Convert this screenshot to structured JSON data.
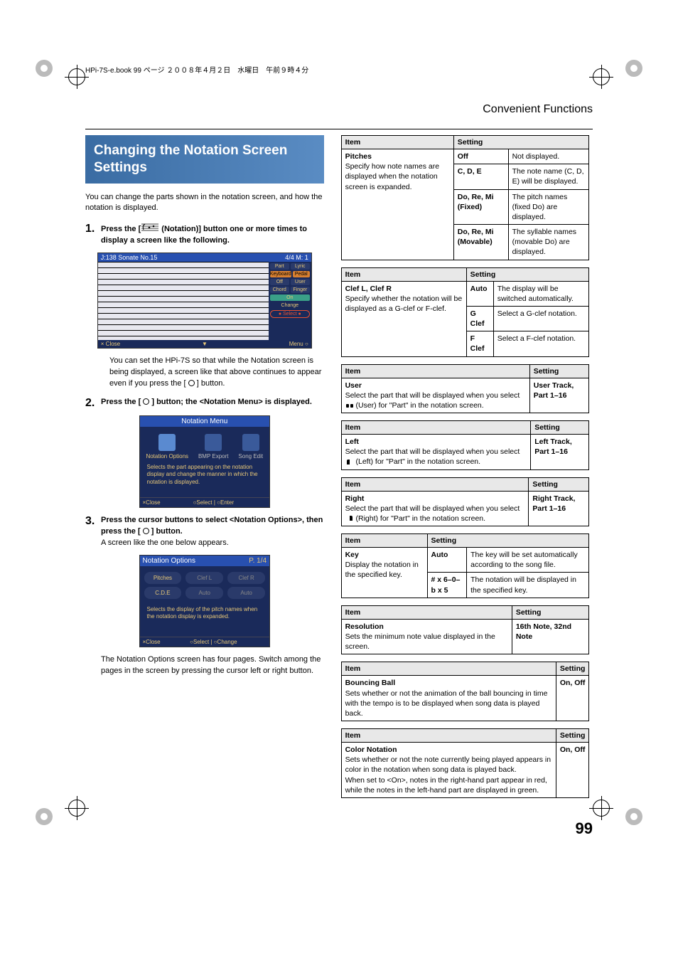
{
  "header_book": "HPi-7S-e.book  99 ページ  ２００８年４月２日　水曜日　午前９時４分",
  "breadcrumb": "Convenient Functions",
  "blue_title": "Changing the Notation Screen Settings",
  "intro": "You can change the parts shown in the notation screen, and how the notation is displayed.",
  "step1_pre": "Press the [",
  "step1_post": " (Notation)] button one or more times to display a screen like the following.",
  "shot1": {
    "title": "J:138 Sonate No.15",
    "meter": "4/4  M:  1",
    "side": {
      "part_l": "Part",
      "lyric": "Lyric",
      "kbd": "Keyboard",
      "pedal": "Pedal",
      "off": "Off",
      "user": "User",
      "chord": "Chord",
      "finger": "Finger",
      "on": "On",
      "change": "Change",
      "select": "Select"
    },
    "foot_l": "× Close",
    "foot_r": "Menu ○"
  },
  "step1_note": "You can set the HPi-7S so that while the Notation screen is being displayed, a screen like that above continues to appear even if you press the [     ] button.",
  "step2": "Press the [      ] button; the <Notation Menu> is displayed.",
  "shot2": {
    "title": "Notation Menu",
    "opt1": "Notation Options",
    "opt2": "BMP Export",
    "opt3": "Song Edit",
    "desc": "Selects the part appearing on the notation display and change the manner in which the notation is displayed.",
    "foot_l": "×Close",
    "foot_c": "○Select",
    "foot_r": "○Enter"
  },
  "step3_a": "Press the cursor buttons to select <Notation Options>, then press the [     ] button.",
  "step3_b": "A screen like the one below appears.",
  "shot3": {
    "title": "Notation Options",
    "pg": "P. 1/4",
    "p1": "Pitches",
    "p2": "Clef L",
    "p3": "Clef R",
    "v1": "C.D.E",
    "v2": "Auto",
    "v3": "Auto",
    "desc": "Selects the display of the pitch names when the notation display is expanded.",
    "foot_l": "×Close",
    "foot_c": "○Select",
    "foot_r": "○Change"
  },
  "step3_foot": "The Notation Options screen has four pages. Switch among the pages in the screen by pressing the cursor left or right button.",
  "th_item": "Item",
  "th_setting": "Setting",
  "t1": {
    "item": "Pitches",
    "desc": "Specify how note names are displayed when the notation screen is expanded.",
    "rows": [
      {
        "s": "Off",
        "d": "Not displayed."
      },
      {
        "s": "C, D, E",
        "d": "The note name (C, D, E) will be displayed."
      },
      {
        "s": "Do, Re, Mi (Fixed)",
        "d": "The pitch names (fixed Do) are displayed."
      },
      {
        "s": "Do, Re, Mi (Movable)",
        "d": "The syllable names (movable Do) are displayed."
      }
    ]
  },
  "t2": {
    "item": "Clef L, Clef R",
    "desc": "Specify whether the notation will be displayed as a G-clef or F-clef.",
    "rows": [
      {
        "s": "Auto",
        "d": "The display will be switched automatically."
      },
      {
        "s": "G Clef",
        "d": "Select a G-clef notation."
      },
      {
        "s": "F Clef",
        "d": "Select a F-clef notation."
      }
    ]
  },
  "t3": {
    "item": "User",
    "desc1": "Select the part that will be displayed when you select ",
    "desc2": " (User) for \"Part\" in the notation screen.",
    "setting": "User Track, Part 1–16"
  },
  "t4": {
    "item": "Left",
    "desc1": "Select the part that will be displayed when you select ",
    "desc2": " (Left) for \"Part\" in the notation screen.",
    "setting": "Left Track, Part 1–16"
  },
  "t5": {
    "item": "Right",
    "desc1": "Select the part that will be displayed when you select ",
    "desc2": " (Right) for \"Part\" in the notation screen.",
    "setting": "Right Track, Part 1–16"
  },
  "t6": {
    "item": "Key",
    "desc": "Display the notation in the specified key.",
    "rows": [
      {
        "s": "Auto",
        "d": "The key will be set automatically according to the song file."
      },
      {
        "s": "# x 6–0– b x 5",
        "d": "The notation will be displayed in the specified key."
      }
    ]
  },
  "t7": {
    "item": "Resolution",
    "desc": "Sets the minimum note value displayed in the screen.",
    "setting": "16th Note, 32nd Note"
  },
  "t8": {
    "item": "Bouncing Ball",
    "desc": "Sets whether or not the animation of the ball bouncing in time with the tempo is to be displayed when song data is played back.",
    "setting": "On, Off"
  },
  "t9": {
    "item": "Color Notation",
    "desc": "Sets whether or not the note currently being played appears in color in the notation when song data is played back.\nWhen set to <On>, notes in the right-hand part appear in red, while the notes in the left-hand part are displayed in green.",
    "setting": "On, Off"
  },
  "page_num": "99"
}
